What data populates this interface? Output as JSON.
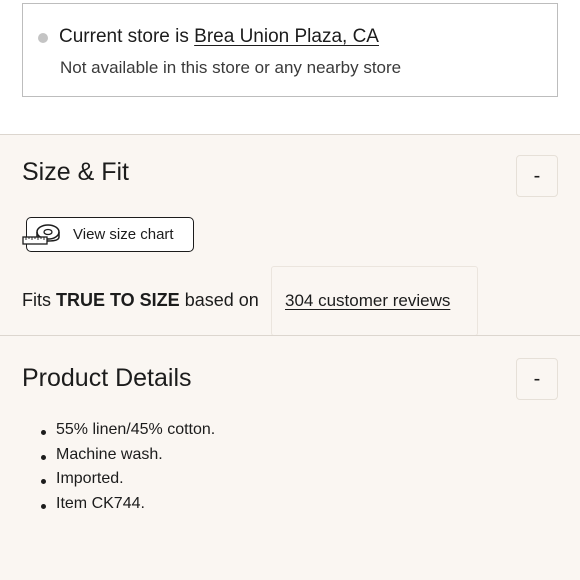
{
  "store": {
    "prefix": "Current store is ",
    "store_name": "Brea Union Plaza, CA",
    "availability": "Not available in this store or any nearby store"
  },
  "size_fit": {
    "title": "Size & Fit",
    "toggle": "-",
    "size_chart_button": "View size chart",
    "fits_prefix": "Fits ",
    "fits_value": "TRUE TO SIZE",
    "fits_suffix": " based on",
    "reviews_link": "304 customer reviews"
  },
  "product_details": {
    "title": "Product Details",
    "toggle": "-",
    "items": [
      "55% linen/45% cotton.",
      "Machine wash.",
      "Imported.",
      "Item CK744."
    ]
  },
  "colors": {
    "section_bg": "#faf6f2",
    "text": "#1c1c1c",
    "dot": "#c4c4c4"
  }
}
